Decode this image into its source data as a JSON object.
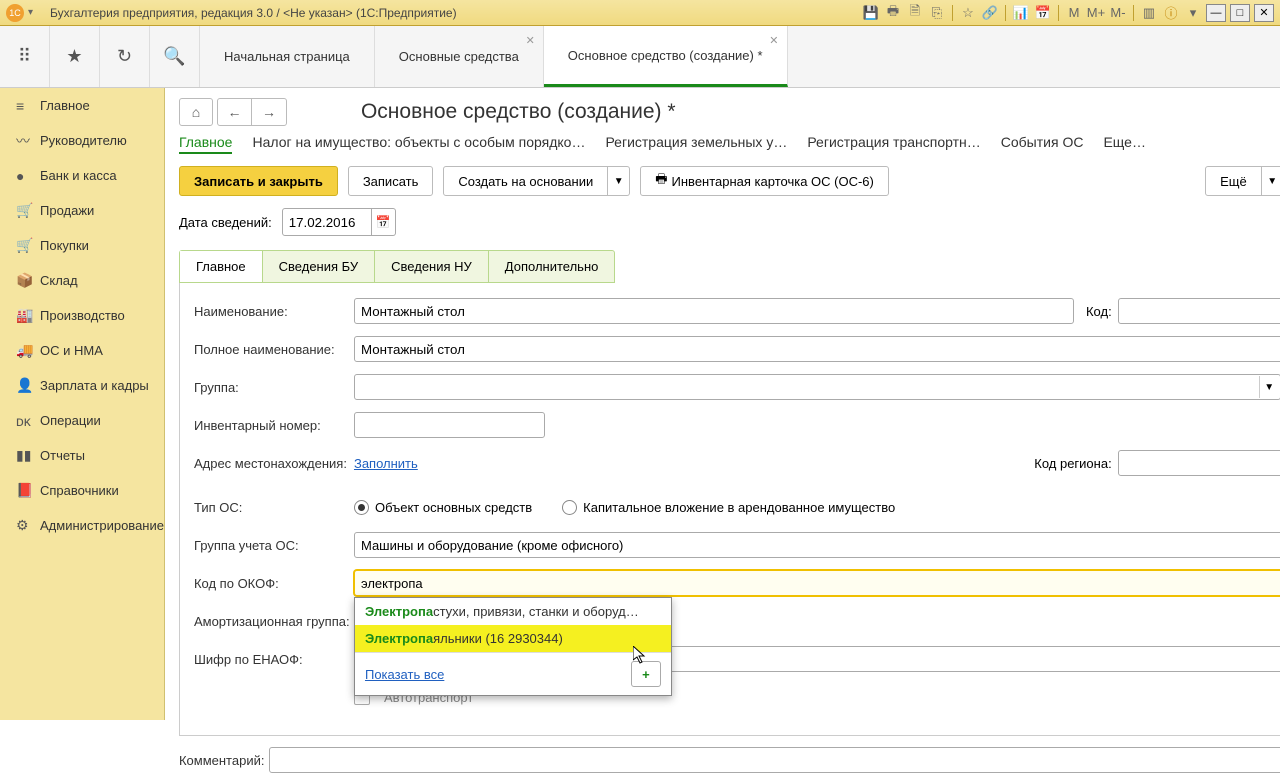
{
  "titlebar": {
    "text": "Бухгалтерия предприятия, редакция 3.0 / <Не указан> (1С:Предприятие)",
    "tool_m": "M",
    "tool_mp": "M+",
    "tool_mm": "M-"
  },
  "toolbar_tabs": {
    "t0": "Начальная страница",
    "t1": "Основные средства",
    "t2": "Основное средство (создание) *"
  },
  "sidebar": {
    "items": [
      {
        "icon": "≡",
        "label": "Главное"
      },
      {
        "icon": "〰",
        "label": "Руководителю"
      },
      {
        "icon": "●",
        "label": "Банк и касса"
      },
      {
        "icon": "🛒",
        "label": "Продажи"
      },
      {
        "icon": "🛒",
        "label": "Покупки"
      },
      {
        "icon": "📦",
        "label": "Склад"
      },
      {
        "icon": "🏭",
        "label": "Производство"
      },
      {
        "icon": "🚚",
        "label": "ОС и НМА"
      },
      {
        "icon": "👤",
        "label": "Зарплата и кадры"
      },
      {
        "icon": "ᴅᴋ",
        "label": "Операции"
      },
      {
        "icon": "▮▮",
        "label": "Отчеты"
      },
      {
        "icon": "📕",
        "label": "Справочники"
      },
      {
        "icon": "⚙",
        "label": "Администрирование"
      }
    ]
  },
  "page": {
    "title": "Основное средство (создание) *",
    "subtabs": {
      "t0": "Главное",
      "t1": "Налог на имущество: объекты с особым порядко…",
      "t2": "Регистрация земельных у…",
      "t3": "Регистрация транспортн…",
      "t4": "События ОС",
      "t5": "Еще…"
    },
    "actions": {
      "save_close": "Записать и закрыть",
      "save": "Записать",
      "create_based": "Создать на основании",
      "inv_card": "Инвентарная карточка ОС (ОС-6)",
      "more": "Ещё",
      "help": "?"
    },
    "date_label": "Дата сведений:",
    "date_value": "17.02.2016",
    "form_tabs": {
      "t0": "Главное",
      "t1": "Сведения БУ",
      "t2": "Сведения НУ",
      "t3": "Дополнительно"
    },
    "form": {
      "name_label": "Наименование:",
      "name_value": "Монтажный стол",
      "code_label": "Код:",
      "fullname_label": "Полное наименование:",
      "fullname_value": "Монтажный стол",
      "group_label": "Группа:",
      "inv_label": "Инвентарный номер:",
      "addr_label": "Адрес местонахождения:",
      "addr_link": "Заполнить",
      "region_label": "Код региона:",
      "type_label": "Тип ОС:",
      "type_radio1": "Объект основных средств",
      "type_radio2": "Капитальное вложение в арендованное имущество",
      "acc_group_label": "Группа учета ОС:",
      "acc_group_value": "Машины и оборудование (кроме офисного)",
      "okof_label": "Код по ОКОФ:",
      "okof_value": "электропа",
      "amort_label": "Амортизационная группа:",
      "enaof_label": "Шифр по ЕНАОФ:",
      "auto_label": "Автотранспорт",
      "comment_label": "Комментарий:"
    },
    "dropdown": {
      "item1_match": "Электропа",
      "item1_rest": "стухи, привязи, станки и оборуд…",
      "item2_match": "Электропа",
      "item2_rest": "яльники (16 2930344)",
      "show_all": "Показать все"
    }
  }
}
